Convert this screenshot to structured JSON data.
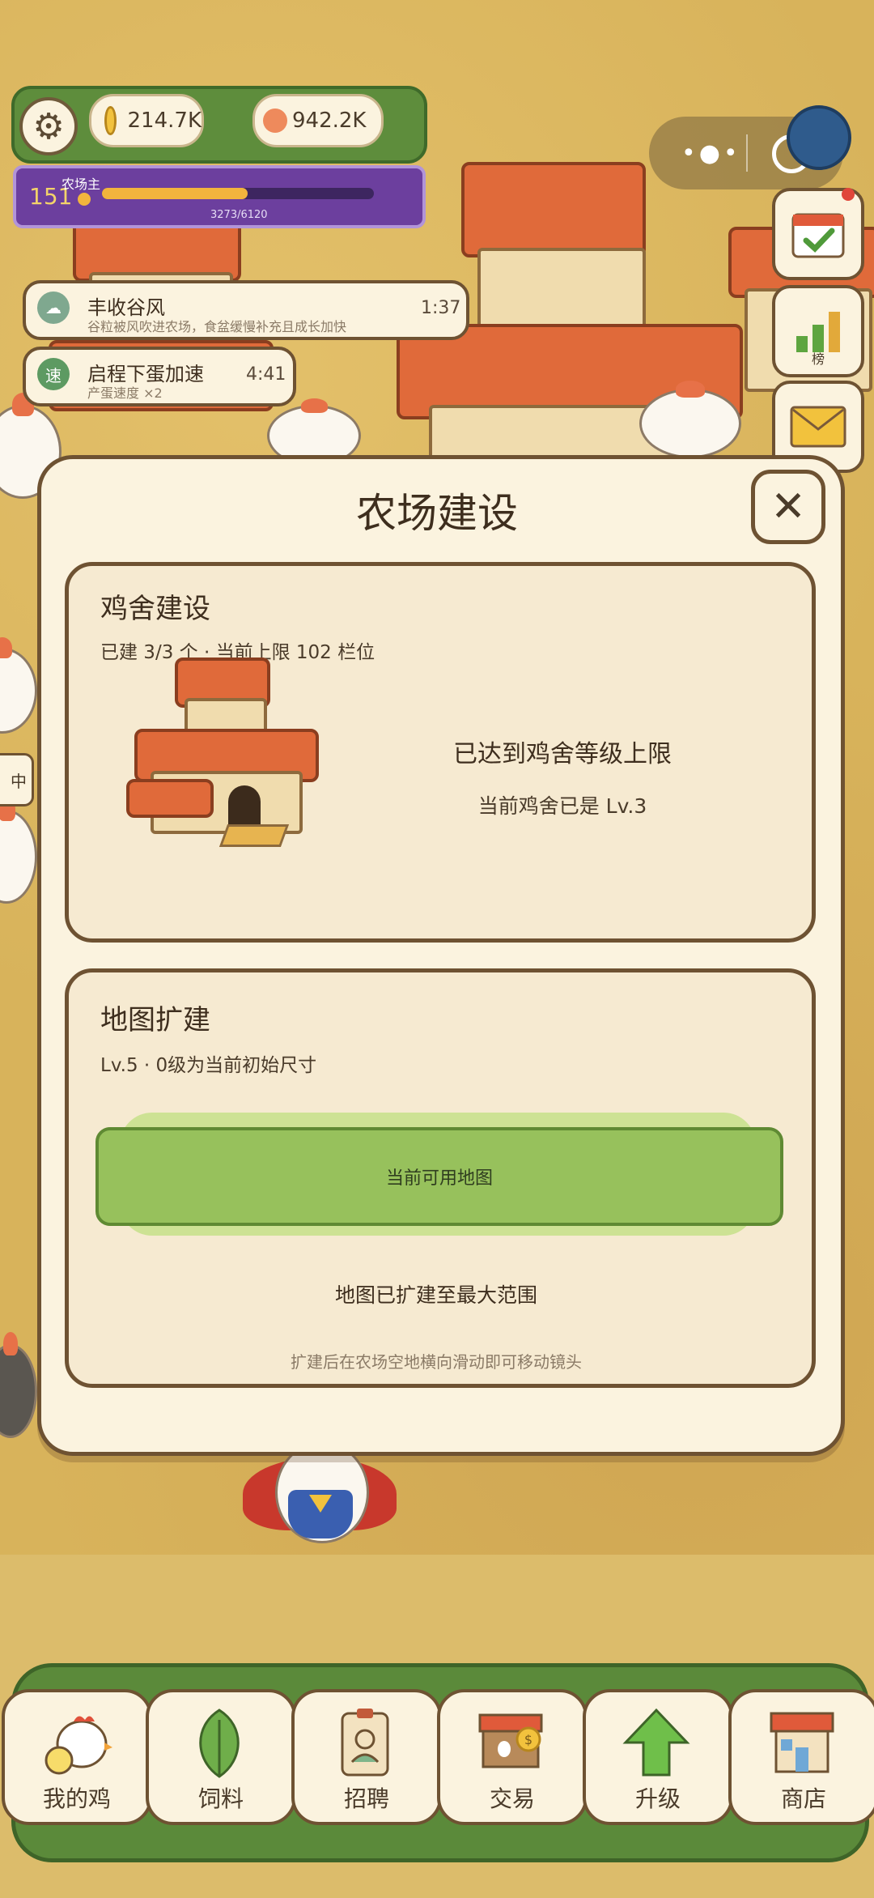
{
  "hud": {
    "coin_value": "214.7K",
    "gem_value": "942.2K",
    "level": "151",
    "rank_title": "农场主",
    "xp_text": "3273/6120",
    "xp_fraction": 0.535
  },
  "buffs": [
    {
      "icon": "cloud-icon",
      "title": "丰收谷风",
      "desc": "谷粒被风吹进农场，食盆缓慢补充且成长加快",
      "time": "1:37"
    },
    {
      "icon_text": "速",
      "title": "启程下蛋加速",
      "desc": "产蛋速度 ×2",
      "time": "4:41"
    }
  ],
  "side_buttons": {
    "rank_label": "榜"
  },
  "modal": {
    "title": "农场建设",
    "close": "✕",
    "coop": {
      "header": "鸡舍建设",
      "sub": "已建 3/3 个 · 当前上限 102 栏位",
      "max_text": "已达到鸡舍等级上限",
      "level_text": "当前鸡舍已是 Lv.3"
    },
    "map": {
      "header": "地图扩建",
      "sub": "Lv.5 · 0级为当前初始尺寸",
      "button": "当前可用地图",
      "max_text": "地图已扩建至最大范围",
      "hint": "扩建后在农场空地横向滑动即可移动镜头"
    }
  },
  "partial_label": "中",
  "tabs": [
    {
      "label": "我的鸡",
      "icon": "chicken-icon"
    },
    {
      "label": "饲料",
      "icon": "leaf-icon"
    },
    {
      "label": "招聘",
      "icon": "id-badge-icon"
    },
    {
      "label": "交易",
      "icon": "market-stall-icon"
    },
    {
      "label": "升级",
      "icon": "up-arrow-icon"
    },
    {
      "label": "商店",
      "icon": "shop-icon"
    }
  ],
  "colors": {
    "panel": "#fbf3df",
    "border": "#6e5232",
    "accent_green": "#97c15c",
    "roof": "#e06a3a"
  }
}
